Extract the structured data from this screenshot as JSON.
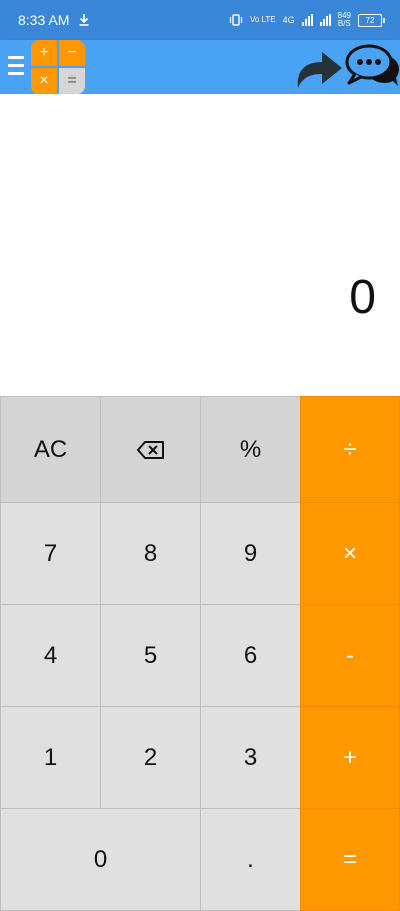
{
  "status_bar": {
    "time": "8:33 AM",
    "volte": "Vo LTE",
    "network": "4G",
    "speed_value": "849",
    "speed_unit": "B/S",
    "battery": "72"
  },
  "display": {
    "result": "0"
  },
  "keys": [
    {
      "label": "AC",
      "type": "top"
    },
    {
      "label": "⌫",
      "type": "top"
    },
    {
      "label": "%",
      "type": "top"
    },
    {
      "label": "÷",
      "type": "op"
    },
    {
      "label": "7",
      "type": "num"
    },
    {
      "label": "8",
      "type": "num"
    },
    {
      "label": "9",
      "type": "num"
    },
    {
      "label": "×",
      "type": "op"
    },
    {
      "label": "4",
      "type": "num"
    },
    {
      "label": "5",
      "type": "num"
    },
    {
      "label": "6",
      "type": "num"
    },
    {
      "label": "-",
      "type": "op"
    },
    {
      "label": "1",
      "type": "num"
    },
    {
      "label": "2",
      "type": "num"
    },
    {
      "label": "3",
      "type": "num"
    },
    {
      "label": "+",
      "type": "op"
    },
    {
      "label": "0",
      "type": "num"
    },
    {
      "label": ".",
      "type": "num"
    },
    {
      "label": "=",
      "type": "op"
    }
  ],
  "logo": {
    "plus": "+",
    "minus": "−",
    "times": "×",
    "equals": "="
  },
  "colors": {
    "status_bar": "#3a86d8",
    "app_bar": "#49a2f4",
    "accent": "#ff9800",
    "key": "#e0e0e0"
  },
  "icons": {
    "menu": "menu-icon",
    "share": "share-icon",
    "chat": "chat-icon",
    "backspace": "backspace-icon",
    "download": "download-icon"
  }
}
